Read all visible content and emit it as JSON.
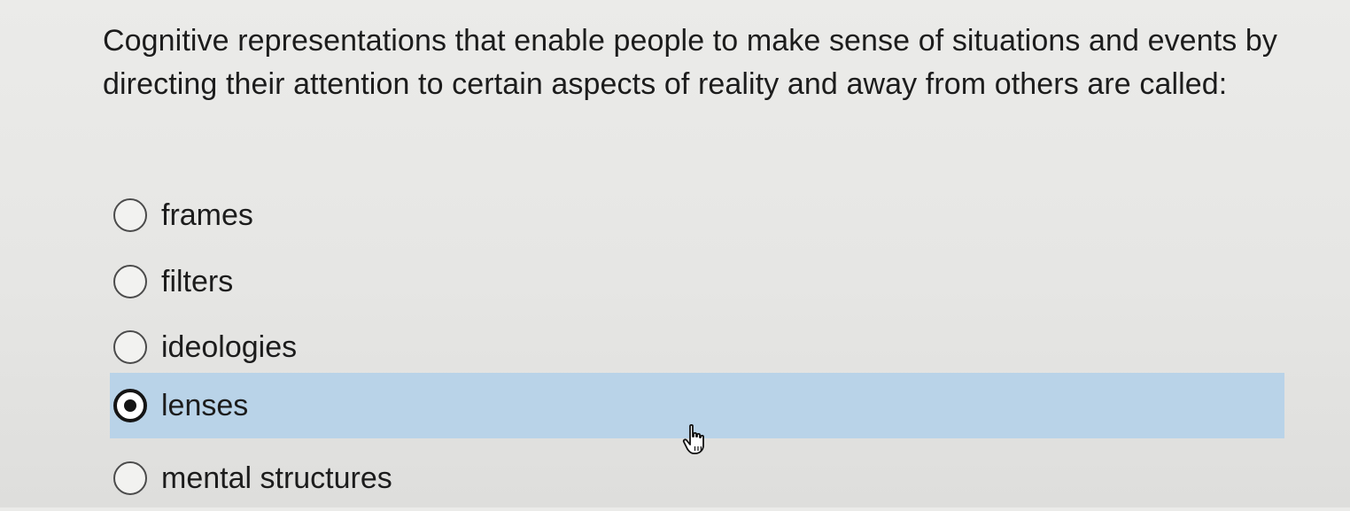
{
  "question": {
    "text": "Cognitive representations that enable people to make sense of situations and events by directing their attention to certain aspects of reality and away from others are called:"
  },
  "options": [
    {
      "label": "frames",
      "selected": false
    },
    {
      "label": "filters",
      "selected": false
    },
    {
      "label": "ideologies",
      "selected": false
    },
    {
      "label": "lenses",
      "selected": true
    },
    {
      "label": "mental structures",
      "selected": false
    }
  ],
  "colors": {
    "selected_row_background": "#b9d3e8",
    "page_background": "#e6e6e4",
    "text": "#1c1c1c"
  },
  "cursor": {
    "icon": "hand-pointer-icon"
  }
}
